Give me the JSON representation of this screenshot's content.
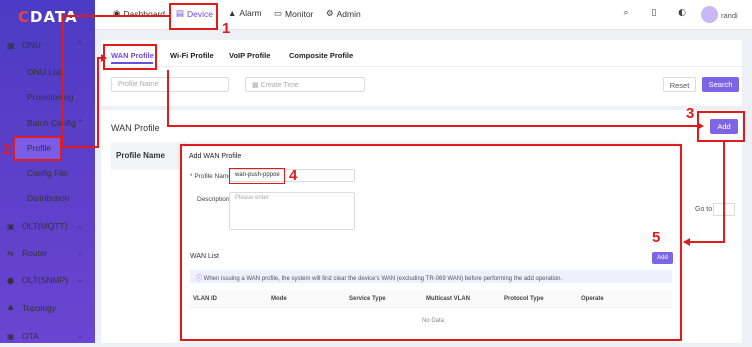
{
  "brand": {
    "logo_c": "C",
    "logo_rest": "DATA"
  },
  "sidebar": {
    "items": [
      {
        "label": "ONU",
        "icon": "▦",
        "chev": "^"
      },
      {
        "label": "ONU List",
        "sub": true
      },
      {
        "label": "Provisioning",
        "sub": true
      },
      {
        "label": "Batch Config",
        "sub": true,
        "chev": "^"
      },
      {
        "label": "Profile",
        "sub": true,
        "active": true
      },
      {
        "label": "Config File",
        "sub": true
      },
      {
        "label": "Distribution",
        "sub": true
      },
      {
        "label": "OLT(MQTT)",
        "icon": "▣",
        "chev": "⌄"
      },
      {
        "label": "Router",
        "icon": "⇆",
        "chev": "⌄"
      },
      {
        "label": "OLT(SNMP)",
        "icon": "●",
        "chev": "⌄"
      },
      {
        "label": "Topology",
        "icon": "♣"
      },
      {
        "label": "OTA",
        "icon": "▣",
        "chev": "⌄"
      }
    ]
  },
  "topnav": {
    "dashboard": "Dashboard",
    "device": "Device",
    "alarm": "Alarm",
    "monitor": "Monitor",
    "admin": "Admin",
    "user": "randi"
  },
  "subtabs": [
    "WAN Profile",
    "Wi-Fi Profile",
    "VoIP Profile",
    "Composite Profile"
  ],
  "filter": {
    "profile_name_placeholder": "Profile Name",
    "create_time_placeholder": "Create Time",
    "reset": "Reset",
    "search": "Search"
  },
  "main": {
    "title": "WAN Profile",
    "add": "Add",
    "col_profile_name": "Profile Name",
    "goto": "Go to"
  },
  "dialog": {
    "title": "Add WAN Profile",
    "profile_name_label": "* Profile Name",
    "profile_name_value": "wan-push-pppoe",
    "description_label": "Description",
    "description_placeholder": "Please enter",
    "wan_list": "WAN List",
    "add": "Add",
    "notice": "When issuing a WAN profile, the system will first clear the device's WAN (excluding TR-069 WAN) before performing the add operation.",
    "columns": [
      "VLAN ID",
      "Mode",
      "Service Type",
      "Multicast VLAN",
      "Protocol Type",
      "Operate"
    ],
    "no_data": "No Data"
  },
  "annotations": {
    "n1": "1",
    "n2": "2",
    "n3": "3",
    "n4": "4",
    "n5": "5"
  },
  "colors": {
    "accent": "#6d4ce0",
    "annotation": "#e01b1b"
  }
}
